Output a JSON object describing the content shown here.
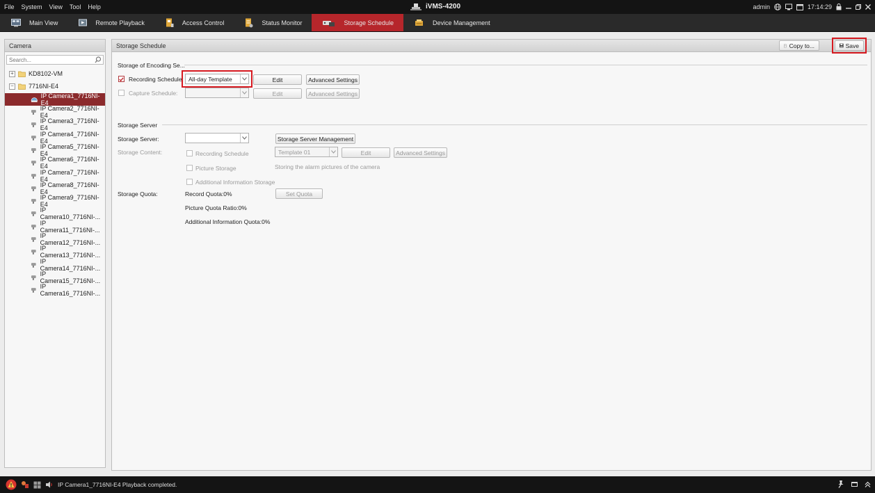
{
  "menu": {
    "items": [
      "File",
      "System",
      "View",
      "Tool",
      "Help"
    ],
    "app_title": "iVMS-4200",
    "user": "admin",
    "time": "17:14:29"
  },
  "tabs": [
    {
      "label": "Main View",
      "icon": "monitor-icon",
      "active": false
    },
    {
      "label": "Remote Playback",
      "icon": "playback-icon",
      "active": false
    },
    {
      "label": "Access Control",
      "icon": "access-control-icon",
      "active": false
    },
    {
      "label": "Status Monitor",
      "icon": "status-monitor-icon",
      "active": false
    },
    {
      "label": "Storage Schedule",
      "icon": "storage-schedule-icon",
      "active": true
    },
    {
      "label": "Device Management",
      "icon": "device-management-icon",
      "active": false
    }
  ],
  "camera_panel": {
    "title": "Camera",
    "search_placeholder": "Search...",
    "groups": [
      {
        "label": "KD8102-VM",
        "expanded": false
      },
      {
        "label": "7716NI-E4",
        "expanded": true
      }
    ],
    "cameras": [
      "IP Camera1_7716NI-E4",
      "IP Camera2_7716NI-E4",
      "IP Camera3_7716NI-E4",
      "IP Camera4_7716NI-E4",
      "IP Camera5_7716NI-E4",
      "IP Camera6_7716NI-E4",
      "IP Camera7_7716NI-E4",
      "IP Camera8_7716NI-E4",
      "IP Camera9_7716NI-E4",
      "IP Camera10_7716NI-...",
      "IP Camera11_7716NI-...",
      "IP Camera12_7716NI-...",
      "IP Camera13_7716NI-...",
      "IP Camera14_7716NI-...",
      "IP Camera15_7716NI-...",
      "IP Camera16_7716NI-..."
    ],
    "selected_index": 0
  },
  "main": {
    "title": "Storage Schedule",
    "copy_label": "Copy to...",
    "save_label": "Save",
    "encoding": {
      "title": "Storage of Encoding Se...",
      "recording_label": "Recording Schedule:",
      "recording_checked": true,
      "recording_value": "All-day Template",
      "capture_label": "Capture Schedule:",
      "capture_checked": false,
      "capture_value": "",
      "edit_label": "Edit",
      "advanced_label": "Advanced Settings"
    },
    "server": {
      "title": "Storage Server",
      "server_label": "Storage Server:",
      "server_value": "",
      "management_label": "Storage Server Management",
      "content_label": "Storage Content:",
      "recording_schedule_label": "Recording Schedule",
      "template_value": "Template 01",
      "edit_label": "Edit",
      "advanced_label": "Advanced Settings",
      "picture_label": "Picture Storage",
      "picture_note": "Storing the alarm pictures of the camera",
      "additional_label": "Additional Information Storage",
      "quota_label": "Storage Quota:",
      "record_quota": "Record Quota:0%",
      "set_quota_label": "Set Quota",
      "picture_quota": "Picture Quota Ratio:0%",
      "additional_quota": "Additional Information Quota:0%"
    }
  },
  "status": {
    "message": "IP Camera1_7716NI-E4 Playback completed."
  },
  "colors": {
    "accent_red": "#b6262b",
    "highlight_red": "#d71920",
    "selected_row": "#8b2a2c",
    "dark_bar": "#141414"
  }
}
